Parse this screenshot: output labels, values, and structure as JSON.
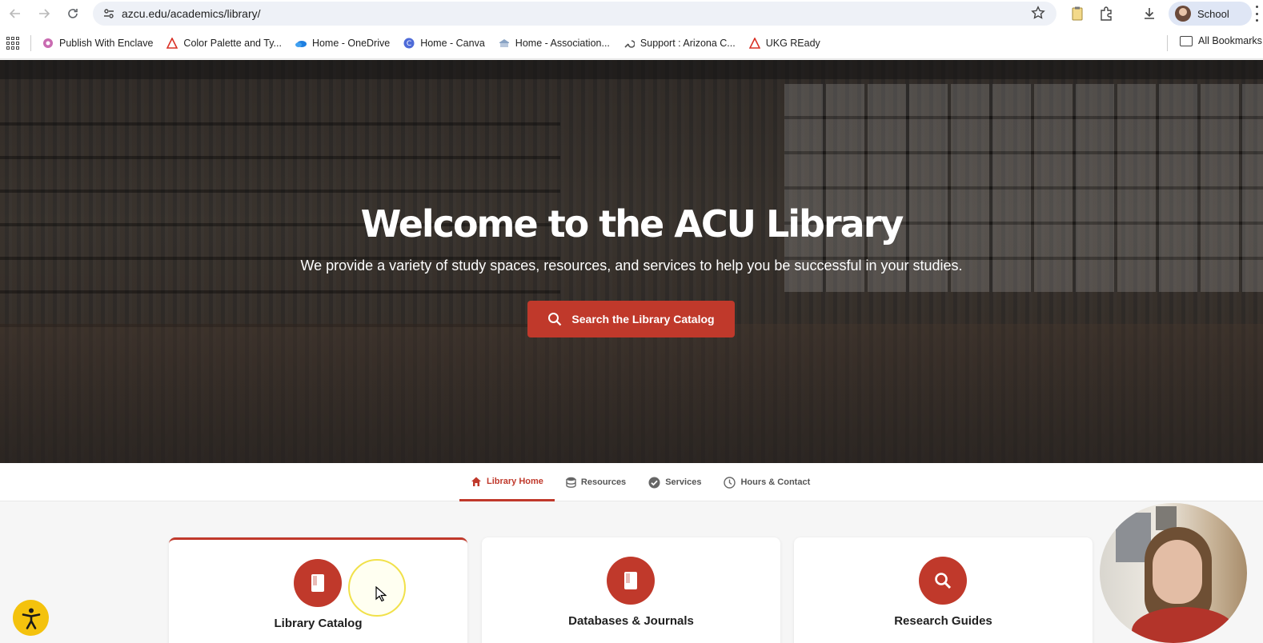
{
  "browser": {
    "url": "azcu.edu/academics/library/",
    "profile_label": "School",
    "bookmarks": [
      {
        "label": "Publish With Enclave",
        "icon": "enclave-icon"
      },
      {
        "label": "Color Palette and Ty...",
        "icon": "color-palette-icon"
      },
      {
        "label": "Home - OneDrive",
        "icon": "onedrive-icon"
      },
      {
        "label": "Home - Canva",
        "icon": "canva-icon"
      },
      {
        "label": "Home - Association...",
        "icon": "association-icon"
      },
      {
        "label": "Support : Arizona C...",
        "icon": "support-icon"
      },
      {
        "label": "UKG REady",
        "icon": "ukg-icon"
      }
    ],
    "all_bookmarks_label": "All Bookmarks"
  },
  "hero": {
    "title": "Welcome to the ACU Library",
    "tagline": "We provide a variety of study spaces, resources, and services to help you be successful in your studies.",
    "cta_label": "Search the Library Catalog"
  },
  "subnav": {
    "tabs": [
      {
        "label": "Library Home",
        "icon": "home-icon",
        "active": true
      },
      {
        "label": "Resources",
        "icon": "database-icon",
        "active": false
      },
      {
        "label": "Services",
        "icon": "check-circle-icon",
        "active": false
      },
      {
        "label": "Hours & Contact",
        "icon": "clock-icon",
        "active": false
      }
    ]
  },
  "cards": [
    {
      "title": "Library Catalog",
      "icon": "book-icon"
    },
    {
      "title": "Databases & Journals",
      "icon": "book-icon"
    },
    {
      "title": "Research Guides",
      "icon": "search-icon"
    }
  ],
  "colors": {
    "accent": "#c0392b",
    "accessibility_button": "#f4c20d"
  }
}
